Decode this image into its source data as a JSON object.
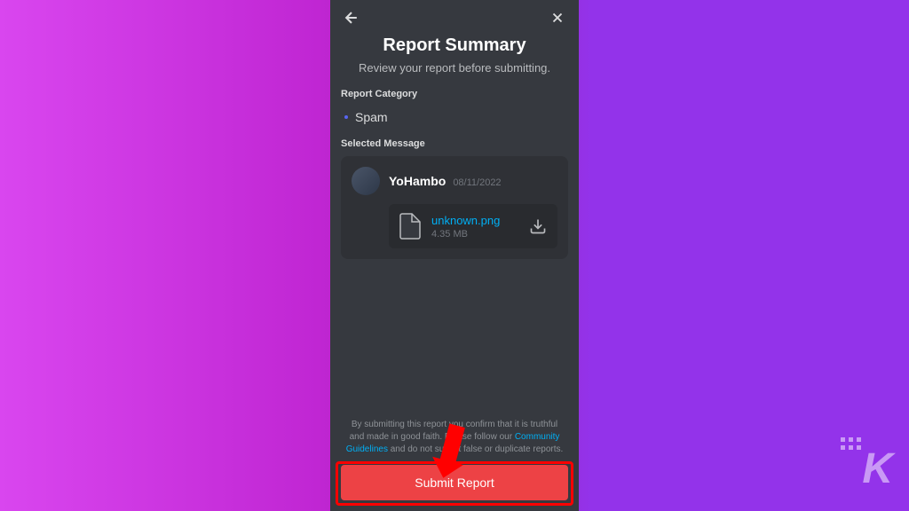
{
  "header": {
    "title": "Report Summary",
    "subtitle": "Review your report before submitting."
  },
  "category": {
    "label": "Report Category",
    "value": "Spam"
  },
  "message": {
    "label": "Selected Message",
    "username": "YoHambo",
    "timestamp": "08/11/2022",
    "attachment": {
      "filename": "unknown.png",
      "size": "4.35 MB"
    }
  },
  "footer": {
    "disclaimer_before": "By submitting this report you confirm that it is truthful and made in good faith. Please follow our ",
    "disclaimer_link": "Community Guidelines",
    "disclaimer_after": " and do not submit false or duplicate reports.",
    "submit_label": "Submit Report"
  },
  "watermark": "K"
}
